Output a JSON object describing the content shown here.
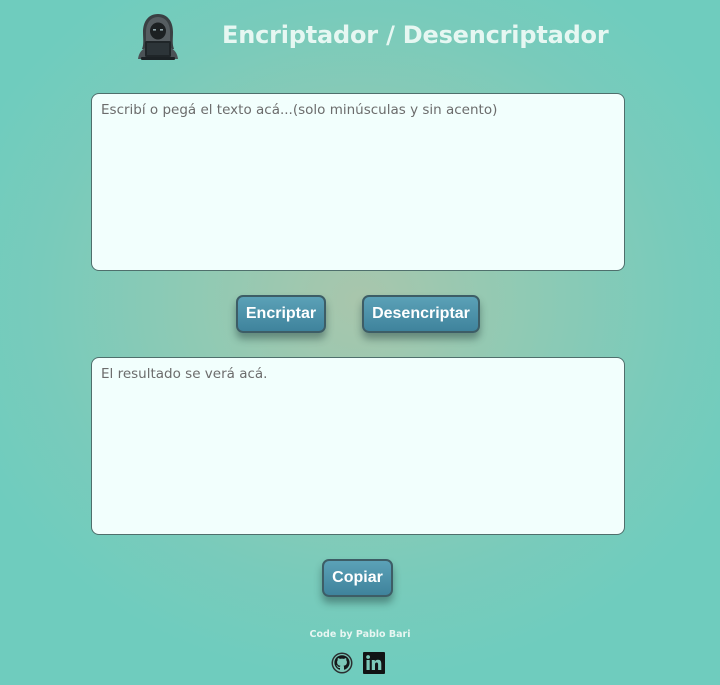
{
  "header": {
    "title": "Encriptador / Desencriptador",
    "logo_icon": "hacker-laptop-icon"
  },
  "input": {
    "placeholder": "Escribí o pegá el texto acá...(solo minúsculas y sin acento)",
    "value": ""
  },
  "buttons": {
    "encrypt_label": "Encriptar",
    "decrypt_label": "Desencriptar",
    "copy_label": "Copiar"
  },
  "output": {
    "placeholder": "El resultado se verá acá.",
    "value": ""
  },
  "footer": {
    "credit": "Code by Pablo Bari",
    "links": [
      {
        "icon": "github-icon"
      },
      {
        "icon": "linkedin-icon"
      }
    ]
  },
  "colors": {
    "button": "#4a90a8",
    "button_border": "#3d5d66",
    "textbox_bg": "#f2fffd",
    "title": "#e6f7f2",
    "background_edge": "#6fccbe",
    "background_center": "#a9c6ac"
  }
}
